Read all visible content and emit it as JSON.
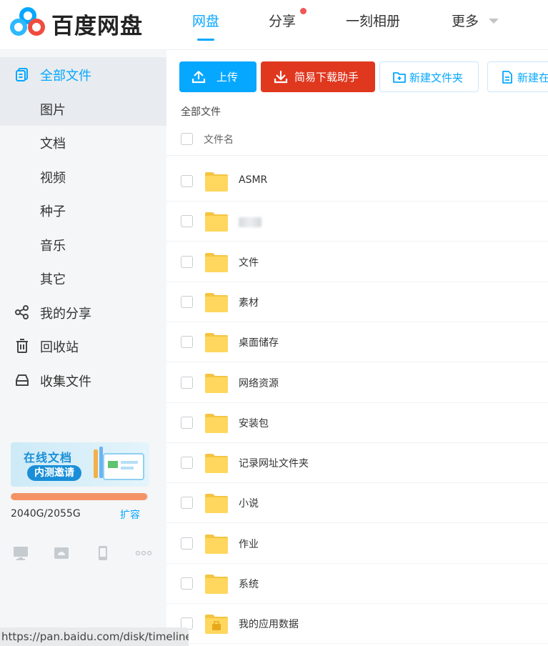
{
  "header": {
    "logo_text": "百度网盘",
    "nav": [
      {
        "label": "网盘"
      },
      {
        "label": "分享"
      },
      {
        "label": "一刻相册"
      },
      {
        "label": "更多"
      }
    ]
  },
  "sidebar": {
    "items": [
      {
        "label": "全部文件"
      },
      {
        "label": "图片"
      },
      {
        "label": "文档"
      },
      {
        "label": "视频"
      },
      {
        "label": "种子"
      },
      {
        "label": "音乐"
      },
      {
        "label": "其它"
      },
      {
        "label": "我的分享"
      },
      {
        "label": "回收站"
      },
      {
        "label": "收集文件"
      }
    ],
    "promo": {
      "title": "在线文档",
      "button": "内测邀请"
    },
    "quota": {
      "text": "2040G/2055G",
      "used_fraction": 0.992,
      "expand": "扩容"
    }
  },
  "toolbar": {
    "upload": "上传",
    "helper": "简易下载助手",
    "new_folder": "新建文件夹",
    "new_doc": "新建在"
  },
  "breadcrumb": "全部文件",
  "list": {
    "column_name": "文件名",
    "files": [
      {
        "name": "ASMR"
      },
      {
        "name": ""
      },
      {
        "name": "文件"
      },
      {
        "name": "素材"
      },
      {
        "name": "桌面储存"
      },
      {
        "name": "网络资源"
      },
      {
        "name": "安装包"
      },
      {
        "name": "记录网址文件夹"
      },
      {
        "name": "小说"
      },
      {
        "name": "作业"
      },
      {
        "name": "系统"
      },
      {
        "name": "我的应用数据"
      }
    ]
  },
  "status_url": "https://pan.baidu.com/disk/timeline",
  "colors": {
    "accent": "#06a7ff",
    "helper": "#e0371f",
    "quota": "#f49466",
    "folder": "#ffd75e"
  }
}
